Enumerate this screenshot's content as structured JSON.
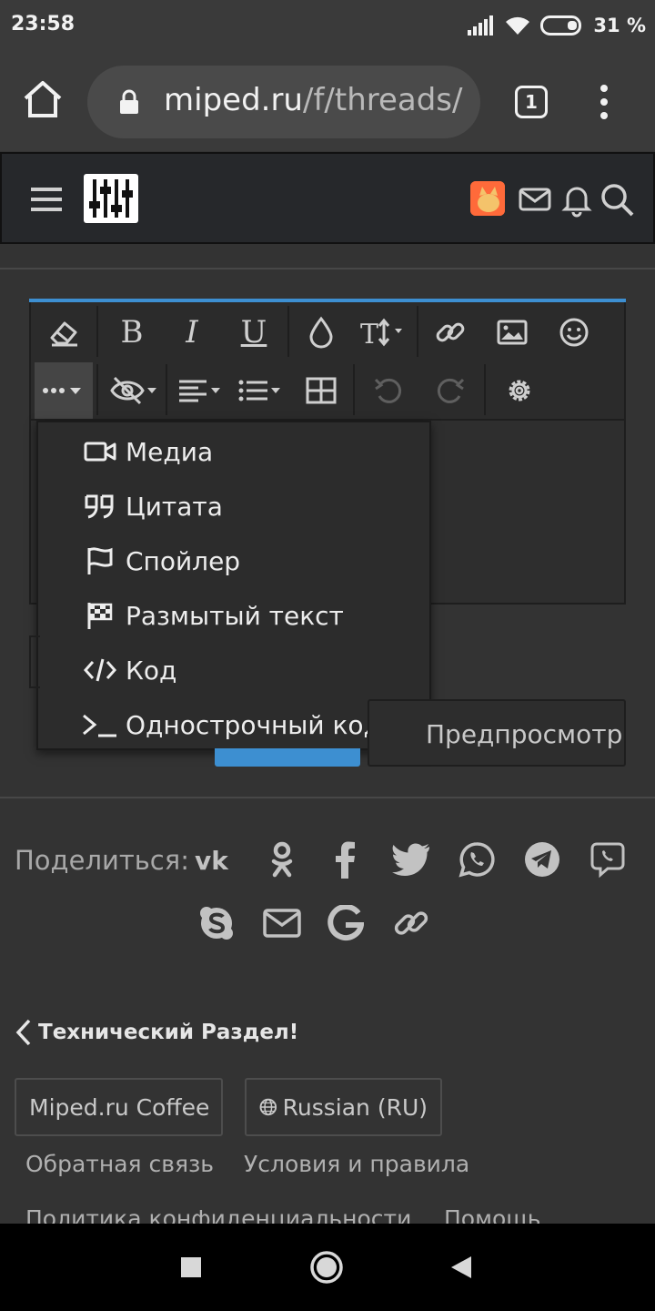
{
  "status_bar": {
    "time": "23:58",
    "battery_pct": "31 %"
  },
  "browser": {
    "url_domain": "miped.ru",
    "url_path": "/f/threads/",
    "tab_count": "1"
  },
  "editor_dropdown": {
    "items": [
      {
        "label": "Медиа",
        "icon": "video-camera-icon"
      },
      {
        "label": "Цитата",
        "icon": "quote-icon"
      },
      {
        "label": "Спойлер",
        "icon": "flag-icon"
      },
      {
        "label": "Размытый текст",
        "icon": "checkered-flag-icon"
      },
      {
        "label": "Код",
        "icon": "code-icon"
      },
      {
        "label": "Однострочный код",
        "icon": "terminal-icon"
      }
    ]
  },
  "buttons": {
    "preview_label": "Предпросмотр"
  },
  "share": {
    "label": "Поделиться:",
    "icons": [
      "vk-icon",
      "odnoklassniki-icon",
      "facebook-icon",
      "twitter-icon",
      "whatsapp-icon",
      "telegram-icon",
      "viber-icon",
      "skype-icon",
      "email-icon",
      "google-icon",
      "link-icon"
    ]
  },
  "footer": {
    "back_label": "Технический Раздел!",
    "style_chip": "Miped.ru Coffee",
    "language_chip": "Russian (RU)",
    "links": [
      "Обратная связь",
      "Условия и правила",
      "Политика конфиденциальности",
      "Помощь"
    ]
  },
  "colors": {
    "accent": "#3d8fd1",
    "background": "#333333",
    "header": "#26282b"
  }
}
